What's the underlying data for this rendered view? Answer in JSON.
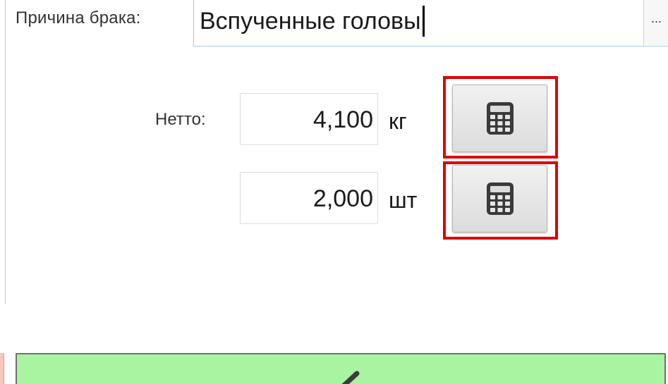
{
  "defect": {
    "label": "Причина брака:",
    "value": "Вспученные головы",
    "more_button_label": "..."
  },
  "weight": {
    "label": "Нетто:",
    "net_value": "4,100",
    "net_unit": "кг",
    "count_value": "2,000",
    "count_unit": "шт"
  },
  "colors": {
    "highlight": "#e00000",
    "confirm_button": "#a9f4a0"
  },
  "icons": {
    "calculator": "calculator-icon",
    "confirm": "check-icon"
  }
}
